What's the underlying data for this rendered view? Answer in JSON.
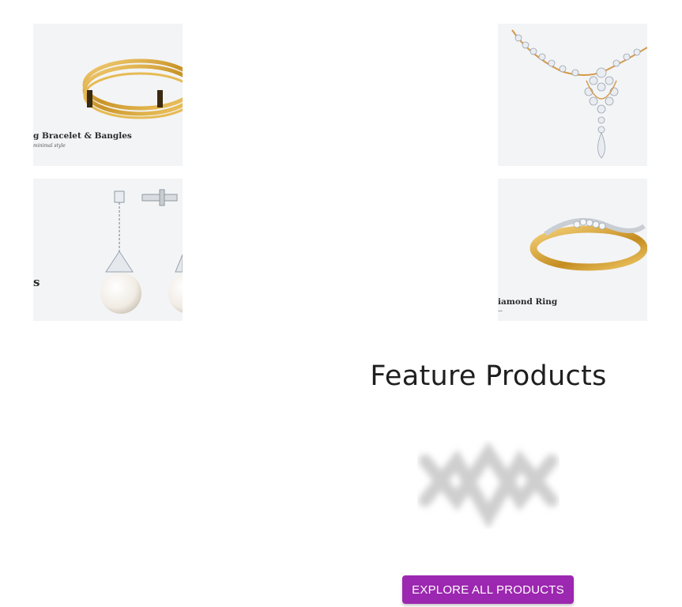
{
  "categories": {
    "bracelet": {
      "caption": "g Bracelet & Bangles",
      "subcaption": "minimal style"
    },
    "necklace": {
      "caption": ""
    },
    "earrings": {
      "caption": "s"
    },
    "ring": {
      "caption": "iamond Ring",
      "subcaption": "—"
    }
  },
  "featured": {
    "title": "Feature Products",
    "placeholder_icon": "blurred-logo-placeholder-icon",
    "button_label": "EXPLORE ALL PRODUCTS"
  },
  "colors": {
    "accent": "#9c27b0",
    "tile_background": "#f3f4f6",
    "gold": "#d4a435",
    "title": "#1f1f1f"
  }
}
